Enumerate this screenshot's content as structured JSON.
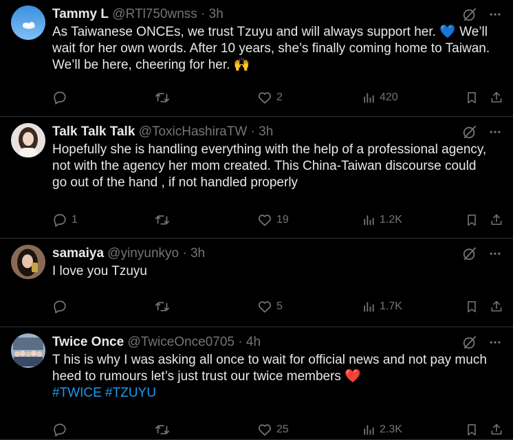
{
  "tweets": [
    {
      "name": "Tammy L",
      "handle": "@RTl750wnss",
      "time": "3h",
      "lines": [
        "As Taiwanese ONCEs, we trust Tzuyu and will always support her.",
        "wait for her own words. After 10 years, she’s finally coming home to Taiwan.",
        "We’ll be here, cheering for her."
      ],
      "line1_tail": "We’ll",
      "emoji1": "💙",
      "emoji2": "🙌",
      "reply_count": "",
      "retweet_count": "",
      "like_count": "2",
      "view_count": "420"
    },
    {
      "name": "Talk Talk Talk",
      "handle": "@ToxicHashiraTW",
      "time": "3h",
      "lines": [
        "Hopefully she is handling everything with the help of a professional agency,",
        "not with the agency her mom created. This China-Taiwan discourse could",
        "go out of the hand , if not handled properly"
      ],
      "reply_count": "1",
      "retweet_count": "",
      "like_count": "19",
      "view_count": "1.2K"
    },
    {
      "name": "samaiya",
      "handle": "@yinyunkyo",
      "time": "3h",
      "lines": [
        "I love you Tzuyu"
      ],
      "reply_count": "",
      "retweet_count": "",
      "like_count": "5",
      "view_count": "1.7K"
    },
    {
      "name": "Twice Once",
      "handle": "@TwiceOnce0705",
      "time": "4h",
      "lines": [
        "T his is why I was asking all once to wait for official news and not pay much",
        "heed to rumours let’s just trust our twice members"
      ],
      "emoji": "❤️",
      "hashtags": "#TWICE #TZUYU",
      "reply_count": "",
      "retweet_count": "",
      "like_count": "25",
      "view_count": "2.3K"
    }
  ],
  "separator": "·",
  "colors": {
    "background": "#000000",
    "text": "#e7e9ea",
    "muted": "#71767b",
    "link": "#1d9bf0",
    "divider": "#2f3336"
  },
  "icons": [
    "grok-icon",
    "more-icon",
    "reply-icon",
    "retweet-icon",
    "like-icon",
    "views-icon",
    "bookmark-icon",
    "share-icon"
  ]
}
